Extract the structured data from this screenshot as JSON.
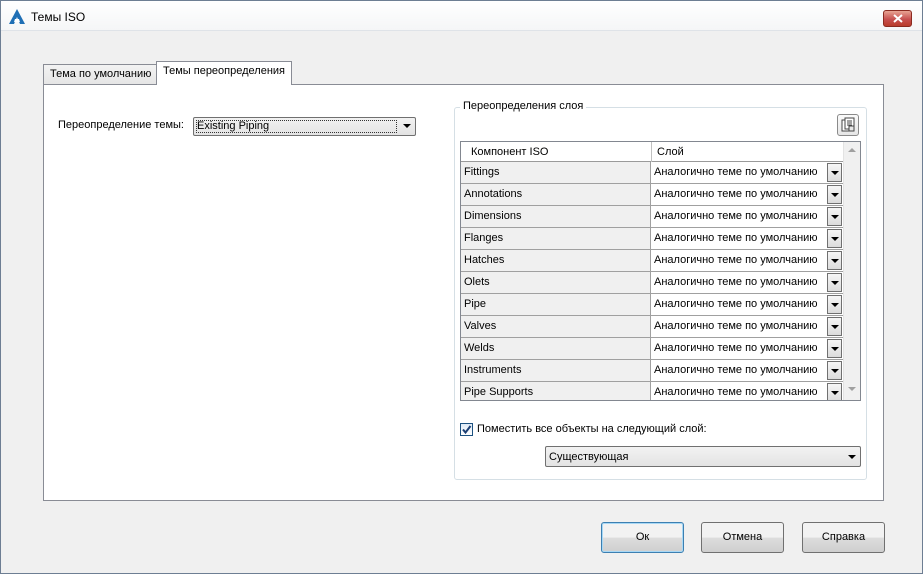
{
  "window": {
    "title": "Темы ISO"
  },
  "tabs": [
    {
      "label": "Тема по умолчанию",
      "active": false
    },
    {
      "label": "Темы переопределения",
      "active": true
    }
  ],
  "override": {
    "label": "Переопределение темы:",
    "selected": "Existing Piping"
  },
  "layer_group": {
    "title": "Переопределения слоя",
    "icon": "layer-properties-icon",
    "columns": [
      "Компонент ISO",
      "Слой"
    ],
    "rows": [
      {
        "component": "Fittings",
        "layer": "Аналогично теме по умолчанию"
      },
      {
        "component": "Annotations",
        "layer": "Аналогично теме по умолчанию"
      },
      {
        "component": "Dimensions",
        "layer": "Аналогично теме по умолчанию"
      },
      {
        "component": "Flanges",
        "layer": "Аналогично теме по умолчанию"
      },
      {
        "component": "Hatches",
        "layer": "Аналогично теме по умолчанию"
      },
      {
        "component": "Olets",
        "layer": "Аналогично теме по умолчанию"
      },
      {
        "component": "Pipe",
        "layer": "Аналогично теме по умолчанию"
      },
      {
        "component": "Valves",
        "layer": "Аналогично теме по умолчанию"
      },
      {
        "component": "Welds",
        "layer": "Аналогично теме по умолчанию"
      },
      {
        "component": "Instruments",
        "layer": "Аналогично теме по умолчанию"
      },
      {
        "component": "Pipe Supports",
        "layer": "Аналогично теме по умолчанию"
      }
    ],
    "place_all": {
      "checked": true,
      "label": "Поместить все объекты на следующий слой:",
      "selected": "Существующая"
    }
  },
  "buttons": {
    "ok": "Ок",
    "cancel": "Отмена",
    "help": "Справка"
  },
  "colors": {
    "accent": "#1c5180",
    "close": "#c75050"
  }
}
